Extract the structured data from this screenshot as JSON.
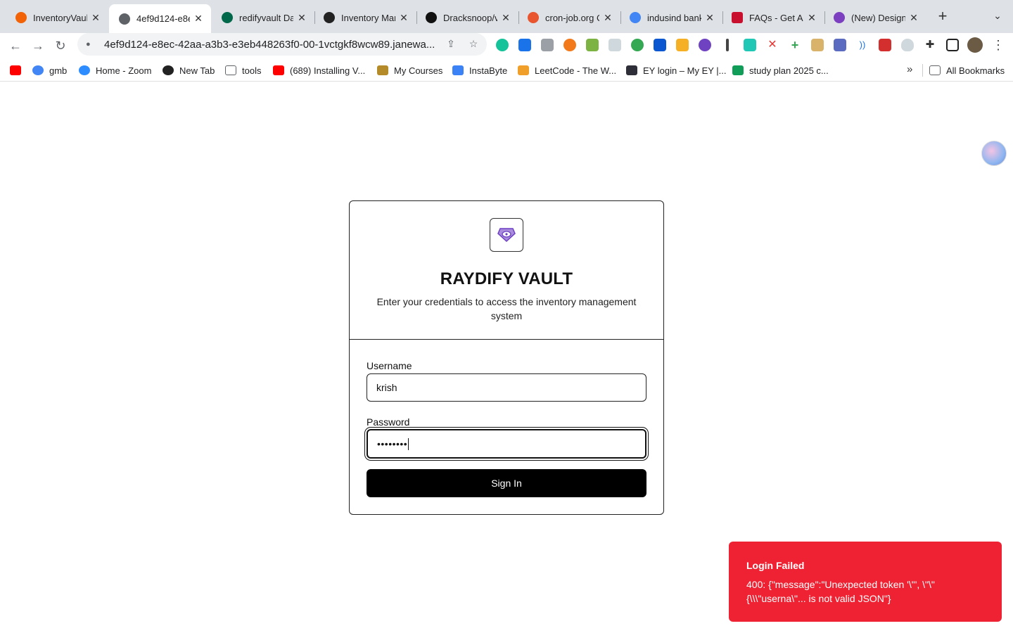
{
  "tabs": [
    {
      "title": "InventoryVault",
      "icon": "replit-icon",
      "color": "#f26207",
      "active": false
    },
    {
      "title": "4ef9d124-e8e",
      "icon": "globe-icon",
      "color": "#5f6368",
      "active": true
    },
    {
      "title": "redifyvault Dat",
      "icon": "mongodb-icon",
      "color": "#00684a",
      "active": false
    },
    {
      "title": "Inventory Man",
      "icon": "openai-icon",
      "color": "#222222",
      "active": false
    },
    {
      "title": "Dracksnoop/v",
      "icon": "github-icon",
      "color": "#111111",
      "active": false
    },
    {
      "title": "cron-job.org C",
      "icon": "cronjob-icon",
      "color": "#e8552f",
      "active": false
    },
    {
      "title": "indusind bank",
      "icon": "google-icon",
      "color": "#4285f4",
      "active": false
    },
    {
      "title": "FAQs - Get An",
      "icon": "faqs-icon",
      "color": "#c8102e",
      "active": false
    },
    {
      "title": "(New) Designe",
      "icon": "designer-icon",
      "color": "#7b3fbf",
      "active": false
    }
  ],
  "toolbar": {
    "url": "4ef9d124-e8ec-42aa-a3b3-e3eb448263f0-00-1vctgkf8wcw89.janewa..."
  },
  "bookmarks": [
    {
      "label": "",
      "icon": "youtube-icon",
      "color": "#ff0000"
    },
    {
      "label": "gmb",
      "icon": "google-icon",
      "color": "#4285f4"
    },
    {
      "label": "Home - Zoom",
      "icon": "zoom-icon",
      "color": "#2d8cff"
    },
    {
      "label": "New Tab",
      "icon": "openai-icon",
      "color": "#222222"
    },
    {
      "label": "tools",
      "icon": "folder-icon",
      "color": "#5f6368"
    },
    {
      "label": "(689) Installing V...",
      "icon": "youtube-icon",
      "color": "#ff0000"
    },
    {
      "label": "My Courses",
      "icon": "courses-icon",
      "color": "#b58b2a"
    },
    {
      "label": "InstaByte",
      "icon": "instabyte-icon",
      "color": "#3b82f6"
    },
    {
      "label": "LeetCode - The W...",
      "icon": "leetcode-icon",
      "color": "#f0a02a"
    },
    {
      "label": "EY login – My EY |...",
      "icon": "ey-icon",
      "color": "#2e2e38"
    },
    {
      "label": "study plan 2025 c...",
      "icon": "sheets-icon",
      "color": "#0f9d58"
    }
  ],
  "all_bookmarks_label": "All Bookmarks",
  "login": {
    "title": "RAYDIFY VAULT",
    "subtitle": "Enter your credentials to access the inventory management system",
    "username_label": "Username",
    "username_value": "krish",
    "password_label": "Password",
    "password_value": "••••••••",
    "submit_label": "Sign In"
  },
  "toast": {
    "title": "Login Failed",
    "message": "400: {\"message\":\"Unexpected token '\\\"', \\\"\\\"{\\\\\\\"userna\\\"... is not valid JSON\"}"
  }
}
